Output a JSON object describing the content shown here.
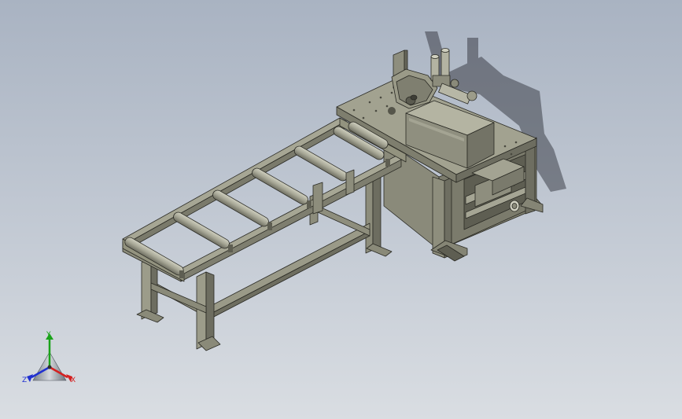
{
  "triad": {
    "labels": {
      "x": "X",
      "y": "Y",
      "z": "Z"
    },
    "colors": {
      "x": "#d42020",
      "y": "#1aa31a",
      "z": "#2030d0"
    }
  },
  "colors": {
    "background_top": "#a9b3c2",
    "background_bottom": "#d9dde2",
    "steel_face": "#9c9c8a",
    "steel_light": "#b7b7a5",
    "steel_dark": "#6a6a5c",
    "edge": "#2a2a24",
    "shadow": "#3c3c44"
  },
  "model": {
    "components": [
      "roller-conveyor",
      "saw-machine",
      "control-box",
      "saw-guard",
      "clamp-cylinders",
      "vise-assembly"
    ],
    "roller_count": 7
  }
}
